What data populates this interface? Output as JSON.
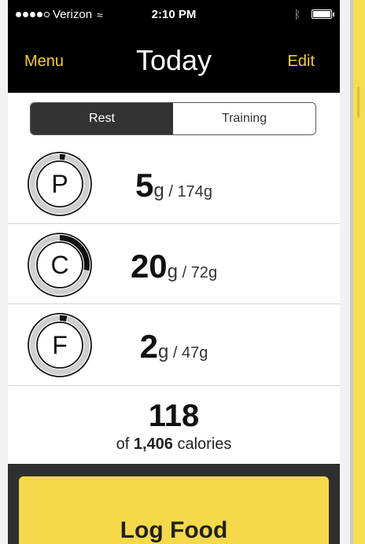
{
  "status_bar": {
    "carrier": "Verizon",
    "time": "2:10 PM"
  },
  "nav": {
    "menu_label": "Menu",
    "title": "Today",
    "edit_label": "Edit"
  },
  "segmented": {
    "options": [
      "Rest",
      "Training"
    ],
    "selected": "Rest"
  },
  "macros": [
    {
      "letter": "P",
      "current": "5",
      "unit": "g",
      "target": "174",
      "target_unit": "g",
      "progress": 0.03
    },
    {
      "letter": "C",
      "current": "20",
      "unit": "g",
      "target": "72",
      "target_unit": "g",
      "progress": 0.28
    },
    {
      "letter": "F",
      "current": "2",
      "unit": "g",
      "target": "47",
      "target_unit": "g",
      "progress": 0.04
    }
  ],
  "calories": {
    "value": "118",
    "prefix": "of",
    "target": "1,406",
    "suffix": "calories"
  },
  "bottom_button": {
    "label": "Log Food"
  },
  "colors": {
    "accent": "#f2cd36",
    "topbar": "#000000",
    "segment_active": "#333333",
    "bottom_button": "#f6d94a"
  }
}
